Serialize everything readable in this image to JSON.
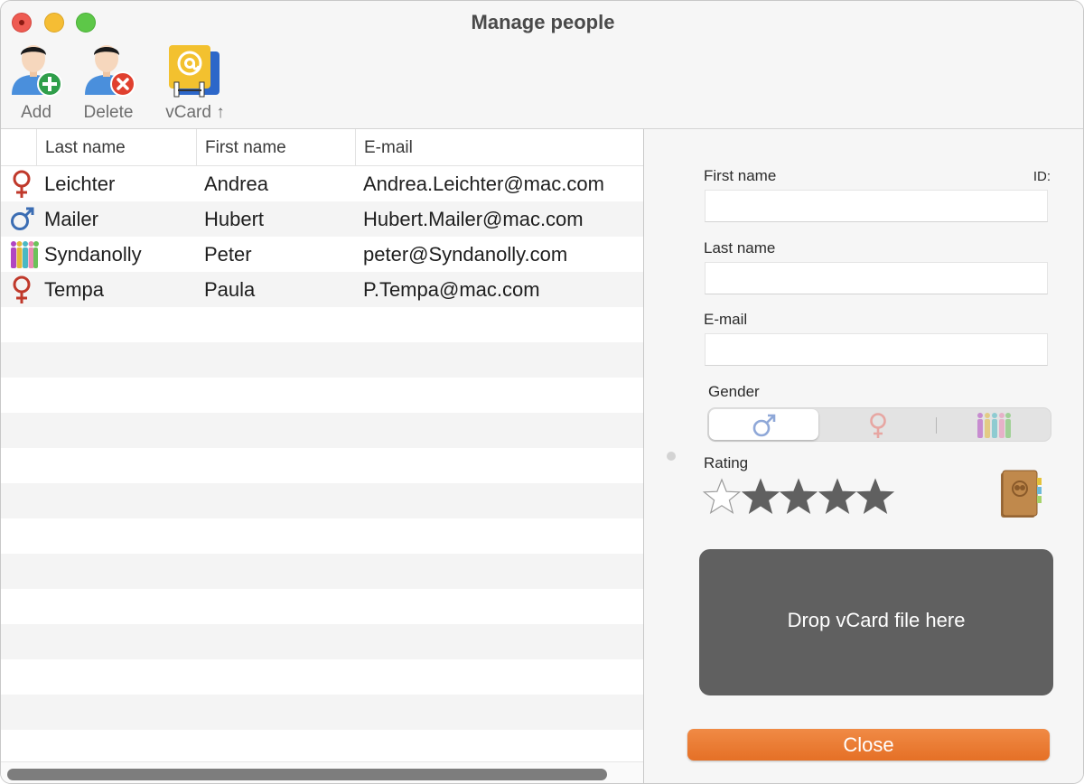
{
  "window": {
    "title": "Manage people"
  },
  "toolbar": {
    "add_label": "Add",
    "delete_label": "Delete",
    "vcard_label": "vCard ↑"
  },
  "table": {
    "columns": [
      "Last name",
      "First name",
      "E-mail"
    ],
    "rows": [
      {
        "gender": "female",
        "last": "Leichter",
        "first": "Andrea",
        "email": "Andrea.Leichter@mac.com"
      },
      {
        "gender": "male",
        "last": "Mailer",
        "first": "Hubert",
        "email": "Hubert.Mailer@mac.com"
      },
      {
        "gender": "group",
        "last": "Syndanolly",
        "first": "Peter",
        "email": "peter@Syndanolly.com"
      },
      {
        "gender": "female",
        "last": "Tempa",
        "first": "Paula",
        "email": "P.Tempa@mac.com"
      }
    ],
    "empty_row_count": 13
  },
  "form": {
    "first_name_label": "First name",
    "id_label": "ID:",
    "first_name_value": "",
    "last_name_label": "Last name",
    "last_name_value": "",
    "email_label": "E-mail",
    "email_value": "",
    "gender_label": "Gender",
    "gender_options": [
      "male",
      "female",
      "group"
    ],
    "gender_selected": "male",
    "rating_label": "Rating",
    "rating_value": 4,
    "rating_max": 5,
    "drop_text": "Drop vCard file here",
    "close_label": "Close"
  },
  "colors": {
    "female": "#c0392b",
    "male": "#3b6db3",
    "accent_orange": "#e97a33",
    "dropzone": "#606060",
    "star_filled": "#606060"
  },
  "icons": {
    "add": "person-plus-icon",
    "delete": "person-delete-icon",
    "vcard": "vcard-export-icon",
    "female": "female-symbol-icon",
    "male": "male-symbol-icon",
    "group": "group-people-icon",
    "address_book": "address-book-icon"
  }
}
